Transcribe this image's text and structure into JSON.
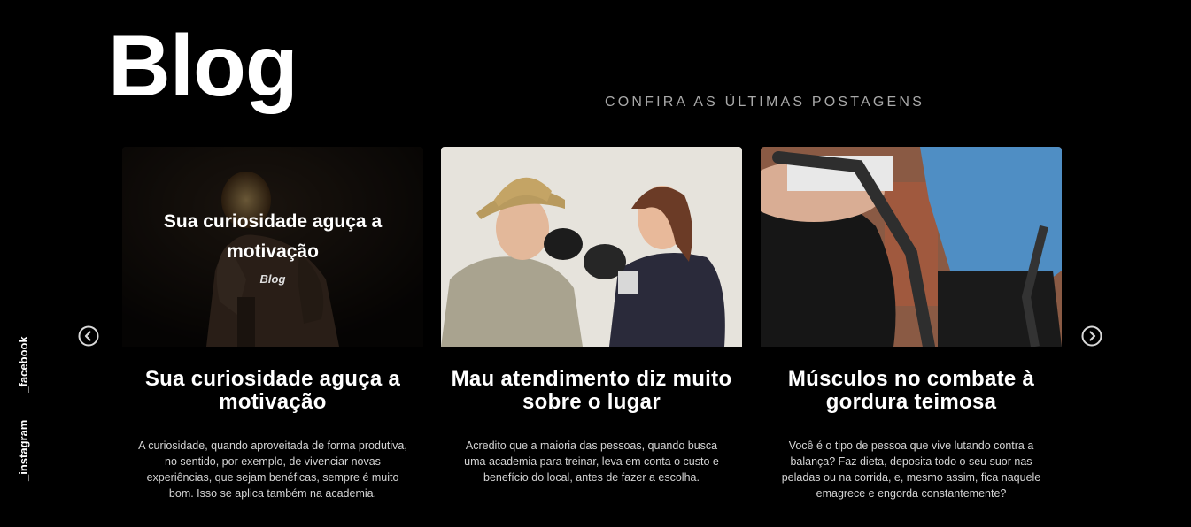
{
  "header": {
    "title": "Blog",
    "subtitle": "CONFIRA AS ÚLTIMAS POSTAGENS"
  },
  "social": {
    "instagram": "_instagram",
    "facebook": "_facebook"
  },
  "carousel": {
    "prev_icon": "chevron-left-circle-icon",
    "next_icon": "chevron-right-circle-icon"
  },
  "posts": [
    {
      "title": "Sua curiosidade aguça a motivação",
      "category": "Blog",
      "image_icon": "athlete-with-bulb-photo",
      "excerpt": "A curiosidade, quando aproveitada de forma produtiva, no sentido, por exemplo, de vivenciar novas experiências, que sejam benéficas, sempre é muito bom. Isso se aplica também na academia."
    },
    {
      "title": "Mau atendimento diz muito sobre o lugar",
      "image_icon": "woman-boxing-man-photo",
      "excerpt": "Acredito que a maioria das pessoas, quando busca uma academia para treinar, leva em conta o custo e benefício do local, antes de fazer a escolha."
    },
    {
      "title": "Músculos no combate à gordura teimosa",
      "image_icon": "treadmill-workout-photo",
      "excerpt": "Você é o tipo de pessoa que vive lutando contra a balança? Faz dieta, deposita todo o seu suor nas peladas ou na corrida, e, mesmo assim, fica naquele emagrece e engorda constantemente?"
    }
  ]
}
